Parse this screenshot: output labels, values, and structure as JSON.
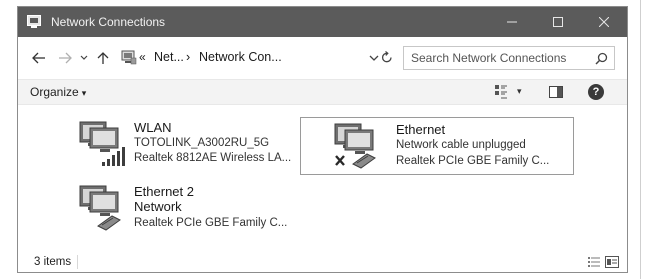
{
  "window": {
    "title": "Network Connections",
    "icons": {
      "app": "network-connections-icon",
      "minimize": "minimize-icon",
      "maximize": "maximize-icon",
      "close": "close-icon"
    }
  },
  "address_bar": {
    "back_icon": "back-arrow-icon",
    "forward_icon": "forward-arrow-icon",
    "recent_icon": "chevron-down-icon",
    "up_icon": "up-arrow-icon",
    "overflow": "«",
    "crumbs": [
      "Net...",
      "Network Con..."
    ],
    "separator": "›",
    "refresh_icon": "refresh-icon"
  },
  "search": {
    "placeholder": "Search Network Connections",
    "value": "",
    "icon": "search-icon"
  },
  "command_bar": {
    "organize_label": "Organize",
    "organize_caret": "▾",
    "view_caret": "▾",
    "help_label": "?"
  },
  "items": [
    {
      "name": "WLAN",
      "line2": "TOTOLINK_A3002RU_5G",
      "line3": "Realtek 8812AE Wireless LA...",
      "icon": "wireless-adapter-icon",
      "status": "connected",
      "selected": false
    },
    {
      "name": "Ethernet",
      "line2": "Network cable unplugged",
      "line3": "Realtek PCIe GBE Family C...",
      "icon": "ethernet-adapter-icon",
      "status": "disconnected",
      "selected": true
    },
    {
      "name": "Ethernet 2",
      "line2": "Network",
      "line3": "Realtek PCIe GBE Family C...",
      "icon": "ethernet-adapter-icon",
      "status": "connected",
      "selected": false
    }
  ],
  "status_bar": {
    "item_count": "3 items",
    "details_view_icon": "details-view-icon",
    "tiles_view_icon": "tiles-view-icon"
  },
  "colors": {
    "titlebar": "#5b5b5b",
    "selection_border": "#9a9a9a",
    "text": "#1a1a1a"
  }
}
